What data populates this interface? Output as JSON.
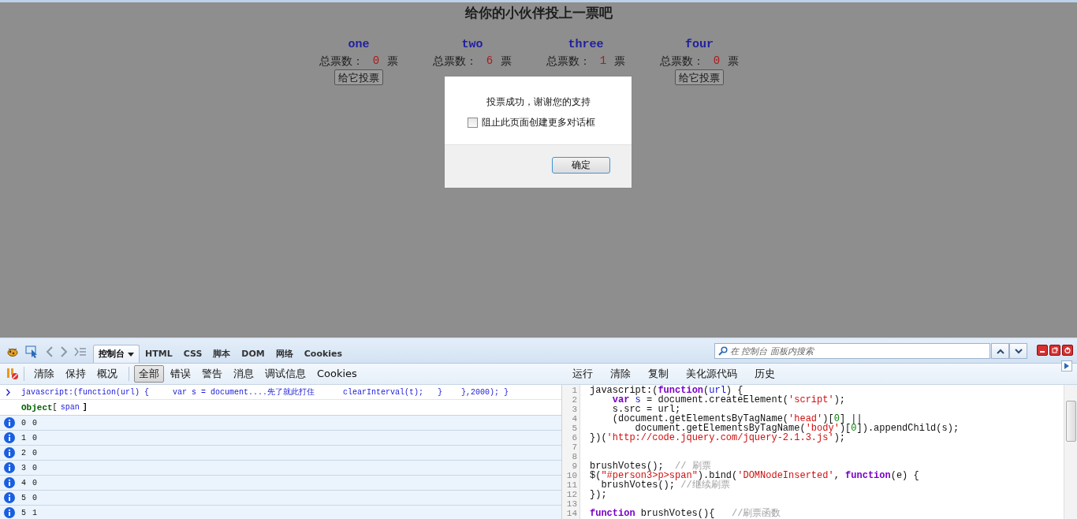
{
  "page": {
    "title": "给你的小伙伴投上一票吧",
    "candidates": [
      {
        "name": "one",
        "label": "总票数：",
        "votes": "0",
        "unit": "票",
        "button": "给它投票"
      },
      {
        "name": "two",
        "label": "总票数：",
        "votes": "6",
        "unit": "票"
      },
      {
        "name": "three",
        "label": "总票数：",
        "votes": "1",
        "unit": "票"
      },
      {
        "name": "four",
        "label": "总票数：",
        "votes": "0",
        "unit": "票",
        "button": "给它投票"
      }
    ]
  },
  "dialog": {
    "message": "投票成功，谢谢您的支持",
    "checkbox": {
      "label": "阻止此页面创建更多对话框",
      "checked": false
    },
    "button": "确定"
  },
  "devtools": {
    "tabs": [
      {
        "label": "控制台",
        "selected": true,
        "dropdown": true
      },
      {
        "label": "HTML",
        "selected": false
      },
      {
        "label": "CSS",
        "selected": false
      },
      {
        "label": "脚本",
        "selected": false
      },
      {
        "label": "DOM",
        "selected": false
      },
      {
        "label": "网络",
        "selected": false
      },
      {
        "label": "Cookies",
        "selected": false
      }
    ],
    "search": {
      "placeholder": "在 控制台 面板内搜索"
    },
    "console_toolbar": [
      [
        {
          "label": "清除",
          "selected": false
        },
        {
          "label": "保持",
          "selected": false
        },
        {
          "label": "概况",
          "selected": false
        }
      ],
      [
        {
          "label": "全部",
          "selected": true
        },
        {
          "label": "错误",
          "selected": false
        },
        {
          "label": "警告",
          "selected": false
        },
        {
          "label": "消息",
          "selected": false
        },
        {
          "label": "调试信息",
          "selected": false
        },
        {
          "label": "Cookies",
          "selected": false
        }
      ]
    ],
    "editor_toolbar": [
      "运行",
      "清除",
      "复制",
      "美化源代码",
      "历史"
    ],
    "console": {
      "command": "javascript:(function(url) {     var s = document....先了就此打住      clearInterval(t);   }    },2000); }",
      "result": {
        "type": "Object",
        "open": "[",
        "value": "span",
        "close": "]"
      },
      "logs": [
        {
          "index": "0",
          "value": "0"
        },
        {
          "index": "1",
          "value": "0"
        },
        {
          "index": "2",
          "value": "0"
        },
        {
          "index": "3",
          "value": "0"
        },
        {
          "index": "4",
          "value": "0"
        },
        {
          "index": "5",
          "value": "0"
        },
        {
          "index": "5",
          "value": "1"
        }
      ]
    },
    "editor": {
      "lines": [
        {
          "number": "1",
          "tokens": [
            {
              "kind": "plain",
              "text": "javascript:("
            },
            {
              "kind": "keyword",
              "text": "function"
            },
            {
              "kind": "plain",
              "text": "("
            },
            {
              "kind": "variable",
              "text": "url"
            },
            {
              "kind": "plain",
              "text": ") {"
            }
          ]
        },
        {
          "number": "2",
          "tokens": [
            {
              "kind": "keyword",
              "text": "    var"
            },
            {
              "kind": "variable",
              "text": " s"
            },
            {
              "kind": "plain",
              "text": " = document.createElement("
            },
            {
              "kind": "string",
              "text": "'script'"
            },
            {
              "kind": "plain",
              "text": ");"
            }
          ]
        },
        {
          "number": "3",
          "tokens": [
            {
              "kind": "plain",
              "text": "    s.src = url;"
            }
          ]
        },
        {
          "number": "4",
          "tokens": [
            {
              "kind": "plain",
              "text": "    (document.getElementsByTagName("
            },
            {
              "kind": "string",
              "text": "'head'"
            },
            {
              "kind": "plain",
              "text": ")["
            },
            {
              "kind": "number",
              "text": "0"
            },
            {
              "kind": "plain",
              "text": "] ||"
            }
          ]
        },
        {
          "number": "5",
          "tokens": [
            {
              "kind": "plain",
              "text": "        document.getElementsByTagName("
            },
            {
              "kind": "string",
              "text": "'body'"
            },
            {
              "kind": "plain",
              "text": ")["
            },
            {
              "kind": "number",
              "text": "0"
            },
            {
              "kind": "plain",
              "text": "]).appendChild(s);"
            }
          ]
        },
        {
          "number": "6",
          "tokens": [
            {
              "kind": "plain",
              "text": "})("
            },
            {
              "kind": "string",
              "text": "'http://code.jquery.com/jquery-2.1.3.js'"
            },
            {
              "kind": "plain",
              "text": ");"
            }
          ]
        },
        {
          "number": "7"
        },
        {
          "number": "8"
        },
        {
          "number": "9",
          "tokens": [
            {
              "kind": "plain",
              "text": "brushVotes();  "
            },
            {
              "kind": "comment",
              "text": "// 刷票"
            }
          ]
        },
        {
          "number": "10",
          "tokens": [
            {
              "kind": "plain",
              "text": "$("
            },
            {
              "kind": "string",
              "text": "\"#person3>p>span\""
            },
            {
              "kind": "plain",
              "text": ").bind("
            },
            {
              "kind": "string",
              "text": "'DOMNodeInserted'"
            },
            {
              "kind": "plain",
              "text": ", "
            },
            {
              "kind": "keyword",
              "text": "function"
            },
            {
              "kind": "plain",
              "text": "(e) {"
            }
          ]
        },
        {
          "number": "11",
          "tokens": [
            {
              "kind": "plain",
              "text": "  brushVotes(); "
            },
            {
              "kind": "comment",
              "text": "//继续刷票"
            }
          ]
        },
        {
          "number": "12",
          "tokens": [
            {
              "kind": "plain",
              "text": "});"
            }
          ]
        },
        {
          "number": "13"
        },
        {
          "number": "14",
          "tokens": [
            {
              "kind": "keyword",
              "text": "function"
            },
            {
              "kind": "plain",
              "text": " brushVotes(){   "
            },
            {
              "kind": "comment",
              "text": "//刷票函数"
            }
          ]
        }
      ]
    }
  }
}
